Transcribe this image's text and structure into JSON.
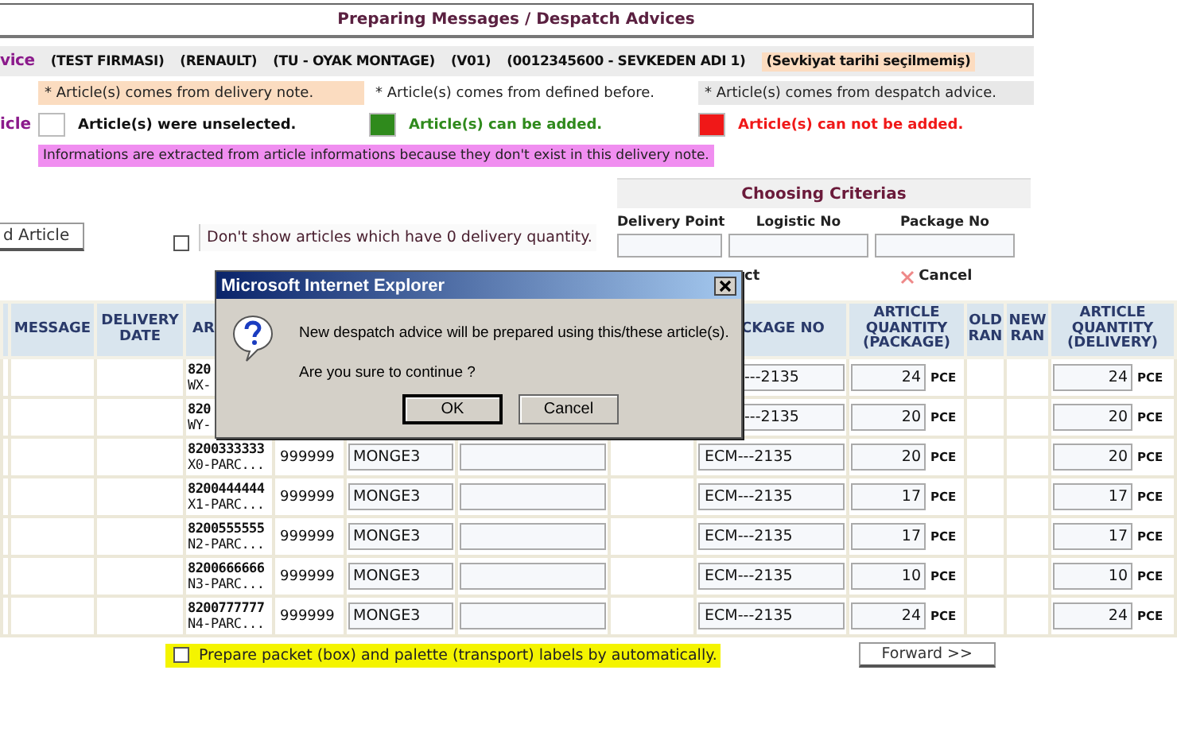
{
  "title": "Preparing Messages / Despatch Advices",
  "info_bar": {
    "label": "vice",
    "items": [
      "(TEST FIRMASI)",
      "(RENAULT)",
      "(TU - OYAK MONTAGE)",
      "(V01)",
      "(0012345600 - SEVKEDEN ADI 1)"
    ],
    "warning": "(Sevkiyat tarihi seçilmemiş)"
  },
  "side_label": "icle",
  "legend": {
    "sources": [
      {
        "text": "* Article(s) comes from delivery note.",
        "color": "#fbdcc0"
      },
      {
        "text": "* Article(s) comes from defined before.",
        "color": "#ffffff"
      },
      {
        "text": "* Article(s) comes from despatch advice.",
        "color": "#e8e8e8"
      }
    ],
    "states": [
      {
        "text": "Article(s) were unselected.",
        "color": "#ffffff"
      },
      {
        "text": "Article(s) can be added.",
        "color": "#2f8a1c"
      },
      {
        "text": "Article(s) can not be added.",
        "color": "#f01818"
      }
    ],
    "note": "Informations are extracted from article informations because they don't exist in this delivery note."
  },
  "add_article_button": "d Article",
  "hide_zero": {
    "label": "Don't show articles which have 0 delivery quantity.",
    "checked": false
  },
  "criteria": {
    "title": "Choosing Criterias",
    "fields": [
      {
        "label": "Delivery Point"
      },
      {
        "label": "Logistic No"
      },
      {
        "label": "Package No"
      }
    ]
  },
  "select_label": "ct",
  "cancel_label": "Cancel",
  "table": {
    "columns": {
      "message": "MESSAGE",
      "delivery_date": "DELIVERY DATE",
      "article": "AR",
      "package_no": "CKAGE NO",
      "qty_package": "ARTICLE QUANTITY (PACKAGE)",
      "old_ran": "OLD RAN",
      "new_ran": "NEW RAN",
      "qty_delivery": "ARTICLE QUANTITY (DELIVERY)"
    },
    "rows": [
      {
        "article_code": "820",
        "article_name": "WX-",
        "package_no": "---2135",
        "qty_package": "24",
        "unit_package": "PCE",
        "qty_delivery": "24",
        "unit_delivery": "PCE"
      },
      {
        "article_code": "820",
        "article_name": "WY-",
        "package_no": "---2135",
        "qty_package": "20",
        "unit_package": "PCE",
        "qty_delivery": "20",
        "unit_delivery": "PCE"
      },
      {
        "article_code": "8200333333",
        "article_name": "X0-PARC...",
        "column_4": "999999",
        "column_5": "MONGE3",
        "package_no": "ECM---2135",
        "qty_package": "20",
        "unit_package": "PCE",
        "qty_delivery": "20",
        "unit_delivery": "PCE"
      },
      {
        "article_code": "8200444444",
        "article_name": "X1-PARC...",
        "column_4": "999999",
        "column_5": "MONGE3",
        "package_no": "ECM---2135",
        "qty_package": "17",
        "unit_package": "PCE",
        "qty_delivery": "17",
        "unit_delivery": "PCE"
      },
      {
        "article_code": "8200555555",
        "article_name": "N2-PARC...",
        "column_4": "999999",
        "column_5": "MONGE3",
        "package_no": "ECM---2135",
        "qty_package": "17",
        "unit_package": "PCE",
        "qty_delivery": "17",
        "unit_delivery": "PCE"
      },
      {
        "article_code": "8200666666",
        "article_name": "N3-PARC...",
        "column_4": "999999",
        "column_5": "MONGE3",
        "package_no": "ECM---2135",
        "qty_package": "10",
        "unit_package": "PCE",
        "qty_delivery": "10",
        "unit_delivery": "PCE"
      },
      {
        "article_code": "8200777777",
        "article_name": "N4-PARC...",
        "column_4": "999999",
        "column_5": "MONGE3",
        "package_no": "ECM---2135",
        "qty_package": "24",
        "unit_package": "PCE",
        "qty_delivery": "24",
        "unit_delivery": "PCE"
      }
    ]
  },
  "auto_labels": {
    "label": "Prepare packet (box) and palette (transport) labels by automatically.",
    "checked": false
  },
  "forward_button": "Forward >>",
  "dialog": {
    "title": "Microsoft Internet Explorer",
    "message": "New despatch advice will be prepared using this/these article(s).",
    "question": "Are you sure to continue ?",
    "buttons": [
      "OK",
      "Cancel"
    ]
  }
}
